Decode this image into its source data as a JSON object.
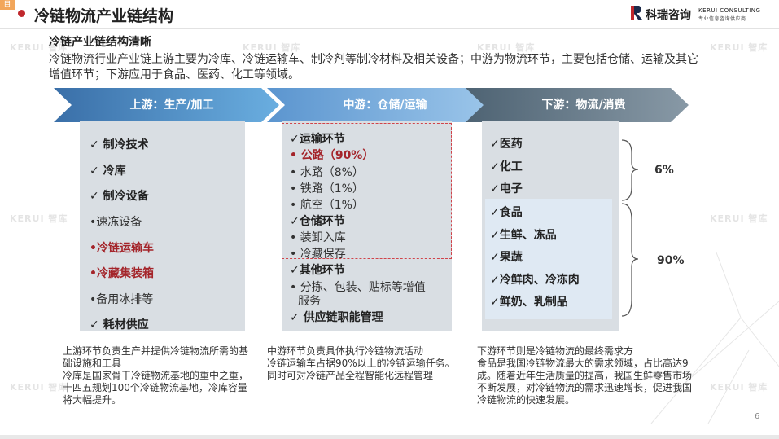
{
  "header": {
    "corner_glyph": "目",
    "title": "冷链物流产业链结构",
    "logo_cn": "科瑞咨询",
    "logo_en": "KERUI CONSULTING",
    "logo_en_sub": "专业信息咨询供应商"
  },
  "watermarks": [
    "KERUI 智库",
    "KERUI 智库",
    "KERUI 智库",
    "KERUI 智库",
    "KERUI 智库",
    "KERUI 智库",
    "KERUI 智库",
    "KERUI 智库"
  ],
  "section": {
    "subtitle": "冷链产业链结构清晰",
    "intro": "冷链物流行业产业链上游主要为冷库、冷链运输车、制冷剂等制冷材料及相关设备；中游为物流环节，主要包括仓储、运输及其它增值环节；下游应用于食品、医药、化工等领域。"
  },
  "stages": [
    "上游：生产/加工",
    "中游：仓储/运输",
    "下游：物流/消费"
  ],
  "upstream": {
    "items": [
      "✓  制冷技术",
      "✓  冷库",
      "✓  制冷设备",
      "•速冻设备",
      "•冷链运输车",
      "•冷藏集装箱",
      "•备用冰排等",
      "✓  耗材供应"
    ],
    "desc": "上游环节负责生产并提供冷链物流所需的基础设施和工具\n冷库是国家骨干冷链物流基地的重中之重，十四五规划100个冷链物流基地，冷库容量将大幅提升。"
  },
  "midstream": {
    "items": [
      "✓运输环节",
      "• 公路（90%）",
      "• 水路（8%）",
      "• 铁路（1%）",
      "• 航空（1%）",
      "✓仓储环节",
      "• 装卸入库",
      "• 冷藏保存",
      "✓其他环节",
      "• 分拣、包装、贴标等增值",
      "服务",
      "✓  供应链职能管理"
    ],
    "desc": "中游环节负责具体执行冷链物流活动\n冷链运输车占据90%以上的冷链运输任务。同时可对冷链产品全程智能化远程管理"
  },
  "downstream": {
    "items": [
      "✓医药",
      "✓化工",
      "✓电子",
      "✓食品",
      "✓生鲜、冻品",
      "✓果蔬",
      "✓冷鲜肉、冷冻肉",
      "✓鲜奶、乳制品"
    ],
    "pct_top": "6%",
    "pct_bottom": "90%",
    "desc": "下游环节则是冷链物流的最终需求方\n食品是我国冷链物流最大的需求领域，占比高达9成。随着近年生活质量的提高，我国生鲜零售市场不断发展，对冷链物流的需求迅速增长，促进我国冷链物流的快速发展。"
  },
  "footer": {
    "page_number": "6"
  },
  "colors": {
    "accent_red": "#c0282d",
    "arrow_light": "#5b9bd5",
    "arrow_dark": "#5f7484",
    "box_gray": "#d9dee3"
  }
}
